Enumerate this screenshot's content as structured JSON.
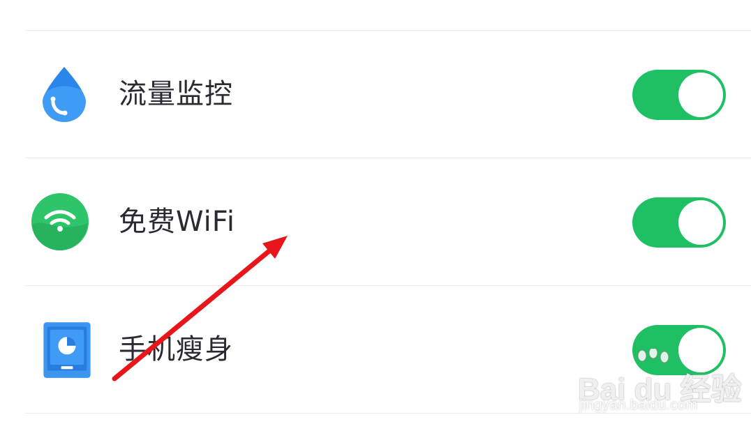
{
  "settings": {
    "items": [
      {
        "label": "流量监控",
        "icon": "water-drop-phone-icon",
        "enabled": true
      },
      {
        "label": "免费WiFi",
        "icon": "wifi-icon",
        "enabled": true
      },
      {
        "label": "手机瘦身",
        "icon": "phone-pie-chart-icon",
        "enabled": true
      }
    ]
  },
  "colors": {
    "toggle_on": "#1fc063",
    "divider": "#ebebeb",
    "label_text": "#2a2a32",
    "drop_blue": "#3f9bf5",
    "wifi_green": "#2ec56a",
    "phone_blue": "#3c95ee",
    "annotation_arrow": "#e8151b"
  },
  "annotation": {
    "type": "arrow",
    "target": "免费WiFi"
  },
  "watermark": {
    "brand": "Bai du 经验",
    "url": "jingyan.baidu.com"
  }
}
